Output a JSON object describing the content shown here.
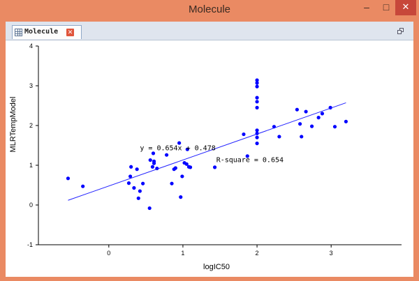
{
  "window": {
    "title": "Molecule",
    "minimize_label": "–",
    "maximize_label": "□",
    "close_label": "✕"
  },
  "tabs": [
    {
      "label": "Molecule",
      "close_label": "✕",
      "icon": "table-icon"
    }
  ],
  "colors": {
    "title_bar": "#ea8a63",
    "point": "#0000ff",
    "line": "#2020ff",
    "close_button": "#c7473a"
  },
  "chart_data": {
    "type": "scatter",
    "xlabel": "logIC50",
    "ylabel": "MLRTempModel",
    "xlim": [
      -0.95,
      3.95
    ],
    "ylim": [
      -1,
      4
    ],
    "xticks": [
      "0",
      "1",
      "2",
      "3"
    ],
    "yticks": [
      "-1",
      "0",
      "1",
      "2",
      "3",
      "4"
    ],
    "grid": false,
    "regression": {
      "slope": 0.654,
      "intercept": 0.478,
      "x_range": [
        -0.55,
        3.2
      ]
    },
    "annotations": {
      "equation": "y = 0.654x + 0.478",
      "r_square": "R-square = 0.654"
    },
    "points": [
      [
        -0.55,
        0.67
      ],
      [
        -0.35,
        0.47
      ],
      [
        0.27,
        0.55
      ],
      [
        0.29,
        0.72
      ],
      [
        0.3,
        0.96
      ],
      [
        0.34,
        0.43
      ],
      [
        0.38,
        0.9
      ],
      [
        0.4,
        0.17
      ],
      [
        0.42,
        0.35
      ],
      [
        0.46,
        0.54
      ],
      [
        0.55,
        -0.08
      ],
      [
        0.56,
        1.13
      ],
      [
        0.59,
        0.96
      ],
      [
        0.6,
        1.3
      ],
      [
        0.61,
        1.05
      ],
      [
        0.61,
        1.1
      ],
      [
        0.65,
        0.92
      ],
      [
        0.78,
        1.26
      ],
      [
        0.85,
        0.54
      ],
      [
        0.88,
        0.9
      ],
      [
        0.9,
        0.93
      ],
      [
        0.95,
        1.56
      ],
      [
        0.97,
        0.2
      ],
      [
        0.99,
        0.72
      ],
      [
        1.02,
        1.06
      ],
      [
        1.05,
        1.03
      ],
      [
        1.06,
        1.4
      ],
      [
        1.08,
        0.96
      ],
      [
        1.1,
        0.95
      ],
      [
        1.43,
        0.95
      ],
      [
        1.82,
        1.78
      ],
      [
        1.87,
        1.23
      ],
      [
        2.0,
        1.55
      ],
      [
        2.0,
        1.7
      ],
      [
        2.0,
        1.8
      ],
      [
        2.0,
        1.88
      ],
      [
        2.0,
        2.45
      ],
      [
        2.0,
        2.6
      ],
      [
        2.0,
        2.7
      ],
      [
        2.0,
        2.98
      ],
      [
        2.0,
        3.07
      ],
      [
        2.0,
        3.14
      ],
      [
        2.23,
        1.97
      ],
      [
        2.3,
        1.72
      ],
      [
        2.54,
        2.4
      ],
      [
        2.58,
        2.04
      ],
      [
        2.6,
        1.72
      ],
      [
        2.66,
        2.35
      ],
      [
        2.74,
        1.98
      ],
      [
        2.83,
        2.2
      ],
      [
        2.88,
        2.3
      ],
      [
        2.99,
        2.45
      ],
      [
        3.05,
        1.97
      ],
      [
        3.2,
        2.1
      ]
    ]
  }
}
